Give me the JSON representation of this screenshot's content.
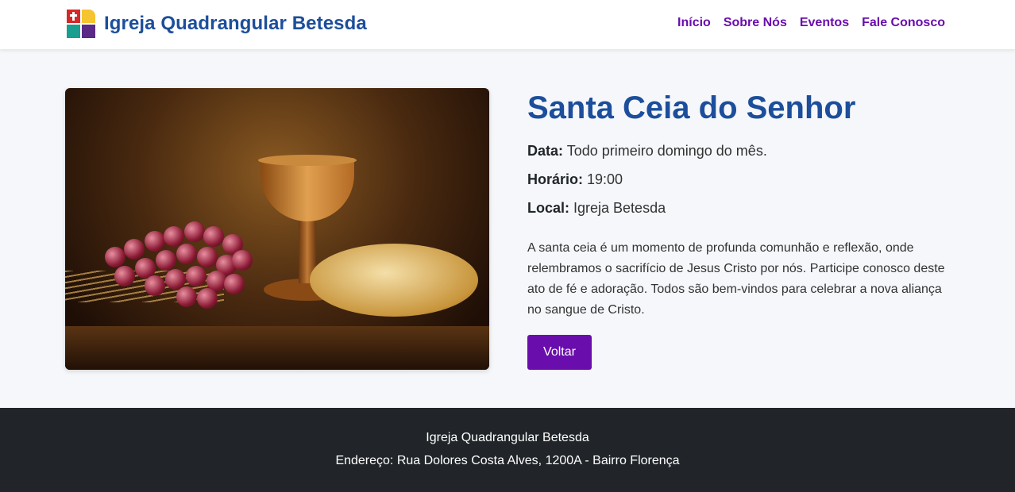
{
  "header": {
    "brand": "Igreja Quadrangular Betesda",
    "nav": [
      "Início",
      "Sobre Nós",
      "Eventos",
      "Fale Conosco"
    ]
  },
  "event": {
    "title": "Santa Ceia do Senhor",
    "date_label": "Data:",
    "date_value": " Todo primeiro domingo do mês.",
    "time_label": "Horário:",
    "time_value": " 19:00",
    "place_label": "Local:",
    "place_value": " Igreja Betesda",
    "description": "A santa ceia é um momento de profunda comunhão e reflexão, onde relembramos o sacrifício de Jesus Cristo por nós. Participe conosco deste ato de fé e adoração. Todos são bem-vindos para celebrar a nova aliança no sangue de Cristo.",
    "back_button": "Voltar"
  },
  "footer": {
    "name": "Igreja Quadrangular Betesda",
    "address": "Endereço: Rua Dolores Costa Alves, 1200A - Bairro Florença"
  },
  "colors": {
    "brand_blue": "#1c4e9b",
    "accent_purple": "#6a0dad",
    "footer_bg": "#212529"
  }
}
